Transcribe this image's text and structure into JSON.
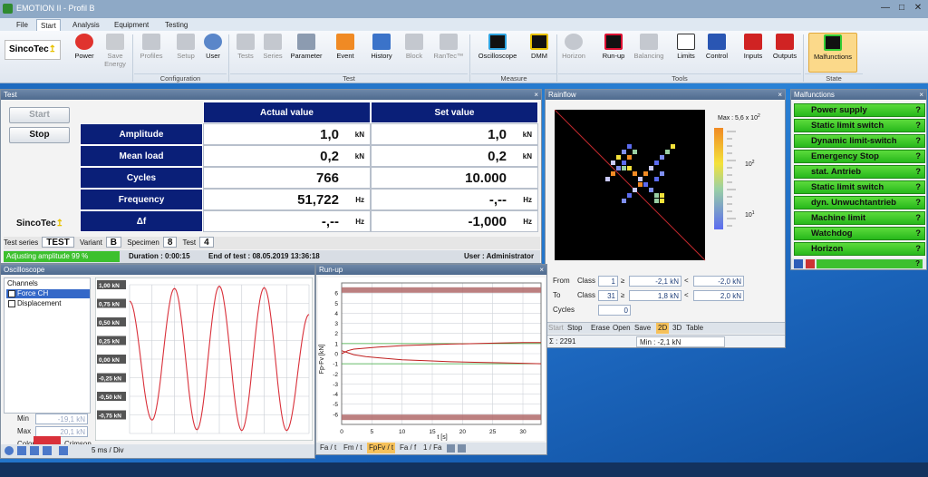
{
  "app": {
    "title": "EMOTION II - Profil B"
  },
  "tabs": [
    "File",
    "Start",
    "Analysis",
    "Equipment",
    "Testing"
  ],
  "ribbon": {
    "logo": "SincoTec",
    "groups": [
      {
        "label": "Configuration"
      },
      {
        "label": "Test"
      },
      {
        "label": "Measure"
      },
      {
        "label": "Tools"
      },
      {
        "label": "State"
      }
    ],
    "buttons": [
      "Power",
      "Save Energy",
      "Profiles",
      "Setup",
      "User",
      "Tests",
      "Series",
      "Parameter",
      "Event",
      "History",
      "Block",
      "RanTec™",
      "Oscilloscope",
      "DMM",
      "Horizon",
      "Run-up",
      "Balancing",
      "Limits",
      "Control",
      "Inputs",
      "Outputs",
      "Malfunctions"
    ]
  },
  "test_panel": {
    "title": "Test",
    "start": "Start",
    "stop": "Stop",
    "logo": "SincoTec",
    "col_actual": "Actual value",
    "col_set": "Set value",
    "rows": [
      {
        "label": "Amplitude",
        "actual": "1,0",
        "actual_unit": "kN",
        "set": "1,0",
        "set_unit": "kN"
      },
      {
        "label": "Mean load",
        "actual": "0,2",
        "actual_unit": "kN",
        "set": "0,2",
        "set_unit": "kN"
      },
      {
        "label": "Cycles",
        "actual": "766",
        "actual_unit": "",
        "set": "10.000",
        "set_unit": ""
      },
      {
        "label": "Frequency",
        "actual": "51,722",
        "actual_unit": "Hz",
        "set": "-,--",
        "set_unit": "Hz"
      },
      {
        "label": "Δf",
        "actual": "-,--",
        "actual_unit": "Hz",
        "set": "-1,000",
        "set_unit": "Hz"
      }
    ],
    "series_label": "Test series",
    "series_value": "TEST",
    "variant_label": "Variant",
    "variant_value": "B",
    "specimen_label": "Specimen",
    "specimen_value": "8",
    "test_label": "Test",
    "test_value": "4",
    "status": "Adjusting amplitude 99 %",
    "duration": "Duration : 0:00:15",
    "end": "End of test : 08.05.2019 13:36:18",
    "user": "User : Administrator"
  },
  "rainflow": {
    "title": "Rainflow",
    "max_label": "Max : 5,6 x 10",
    "max_exp": "2",
    "scale_hi": "10",
    "scale_hi_exp": "2",
    "scale_lo": "10",
    "scale_lo_exp": "1",
    "from_label": "From",
    "to_label": "To",
    "cycles_label": "Cycles",
    "class_label": "Class",
    "from_class": "1",
    "from_min": "-2,1 kN",
    "from_max": "-2,0 kN",
    "to_class": "31",
    "to_min": "1,8 kN",
    "to_max": "2,0 kN",
    "cycles": "0",
    "ge": "≥",
    "lt": "<",
    "toolbar": [
      "Start",
      "Stop",
      "Erase",
      "Open",
      "Save",
      "2D",
      "3D",
      "Table"
    ],
    "sum": "Σ : 2291",
    "min": "Min : -2,1 kN"
  },
  "malfunctions": {
    "title": "Malfunctions",
    "items": [
      "Power supply",
      "Static limit switch",
      "Dynamic limit-switch",
      "Emergency Stop",
      "stat. Antrieb",
      "Static limit switch",
      "dyn. Unwuchtantrieb",
      "Machine limit",
      "Watchdog",
      "Horizon"
    ],
    "q": "?",
    "footer_q": "?"
  },
  "oscilloscope": {
    "title": "Oscilloscope",
    "channels_label": "Channels",
    "channels": [
      "Force CH",
      "Displacement"
    ],
    "min_label": "Min",
    "min_value": "-19,1 kN",
    "max_label": "Max",
    "max_value": "20,1 kN",
    "color_label": "Color",
    "crimson_label": "Crimson",
    "timebase": "5 ms / Div",
    "y_labels": [
      "1,00 kN",
      "0,75 kN",
      "0,50 kN",
      "0,25 kN",
      "0,00 kN",
      "-0,25 kN",
      "-0,50 kN",
      "-0,75 kN"
    ],
    "colors": {
      "trace": "#d9303a"
    }
  },
  "runup": {
    "title": "Run-up",
    "ylabel": "Fp-Fv [kN]",
    "xlabel": "t [s]",
    "tabs": [
      "Fa / t",
      "Fm / t",
      "FpFv / t",
      "Fa / f",
      "1 / Fa"
    ]
  },
  "chart_data": [
    {
      "type": "line",
      "title": "",
      "xlabel": "",
      "ylabel": "",
      "ylim": [
        -1.0,
        1.0
      ],
      "series": [
        {
          "name": "Force CH",
          "x": [
            0,
            1,
            2,
            3,
            4,
            5,
            6,
            7,
            8
          ],
          "values": [
            0.78,
            -0.82,
            0.95,
            -0.95,
            0.98,
            -0.96,
            0.96,
            -0.96,
            0.6
          ]
        }
      ],
      "x_axis": "time, 5 ms / Div",
      "color": "#d9303a"
    },
    {
      "type": "line",
      "title": "",
      "xlabel": "t [s]",
      "ylabel": "Fp-Fv [kN]",
      "xlim": [
        0,
        33
      ],
      "ylim": [
        -7,
        7
      ],
      "x_ticks": [
        0,
        5,
        10,
        15,
        20,
        25,
        30
      ],
      "y_ticks": [
        -6,
        -5,
        -4,
        -3,
        -2,
        -1,
        0,
        1,
        2,
        3,
        4,
        5,
        6
      ],
      "series": [
        {
          "x": [
            0,
            1,
            2,
            4,
            6,
            8,
            10,
            14,
            18,
            22,
            26,
            30,
            33
          ],
          "values": [
            0.3,
            0.1,
            -0.1,
            -0.3,
            -0.4,
            -0.5,
            -0.6,
            -0.7,
            -0.8,
            -0.85,
            -0.9,
            -0.95,
            -1.0
          ],
          "color": "#c02020"
        },
        {
          "x": [
            0,
            1,
            2,
            4,
            6,
            8,
            10,
            14,
            18,
            22,
            26,
            30,
            33
          ],
          "values": [
            0.0,
            0.3,
            0.45,
            0.55,
            0.65,
            0.72,
            0.8,
            0.88,
            0.95,
            1.0,
            1.05,
            1.1,
            1.1
          ],
          "color": "#c02020"
        }
      ],
      "limit_lines": [
        1.0,
        -1.0
      ],
      "limit_bands": [
        6.3,
        -6.3
      ]
    }
  ]
}
